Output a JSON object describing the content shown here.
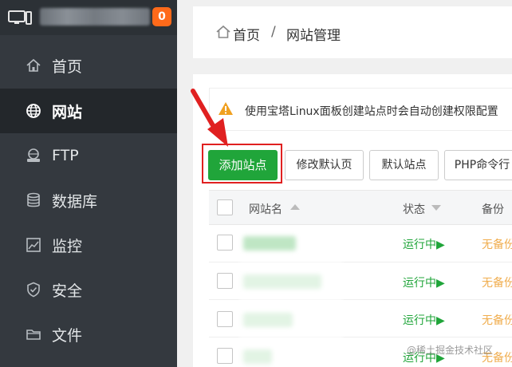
{
  "sidebar": {
    "badge": "0",
    "items": [
      {
        "label": "首页",
        "icon": "home-icon"
      },
      {
        "label": "网站",
        "icon": "globe-icon"
      },
      {
        "label": "FTP",
        "icon": "ftp-icon"
      },
      {
        "label": "数据库",
        "icon": "database-icon"
      },
      {
        "label": "监控",
        "icon": "monitor-chart-icon"
      },
      {
        "label": "安全",
        "icon": "shield-icon"
      },
      {
        "label": "文件",
        "icon": "folder-icon"
      }
    ],
    "active_index": 1
  },
  "breadcrumb": {
    "home": "首页",
    "separator": "/",
    "current": "网站管理"
  },
  "notice": {
    "text": "使用宝塔Linux面板创建站点时会自动创建权限配置"
  },
  "toolbar": {
    "add_site": "添加站点",
    "modify_default_page": "修改默认页",
    "default_site": "默认站点",
    "php_cli": "PHP命令行"
  },
  "table": {
    "headers": {
      "site_name": "网站名",
      "status": "状态",
      "backup": "备份"
    },
    "rows": [
      {
        "status": "运行中▶",
        "backup": "无备份"
      },
      {
        "status": "运行中▶",
        "backup": "无备份"
      },
      {
        "status": "运行中▶",
        "backup": "无备份"
      },
      {
        "status": "运行中▶",
        "backup": "无备份"
      }
    ]
  },
  "watermark": "@稀土掘金技术社区",
  "colors": {
    "sidebar_bg": "#34393f",
    "active_bg": "#23272b",
    "accent_green": "#20a53a",
    "badge_orange": "#ff6a1a",
    "warn_orange": "#f0ad4e",
    "highlight_red": "#e02020"
  }
}
